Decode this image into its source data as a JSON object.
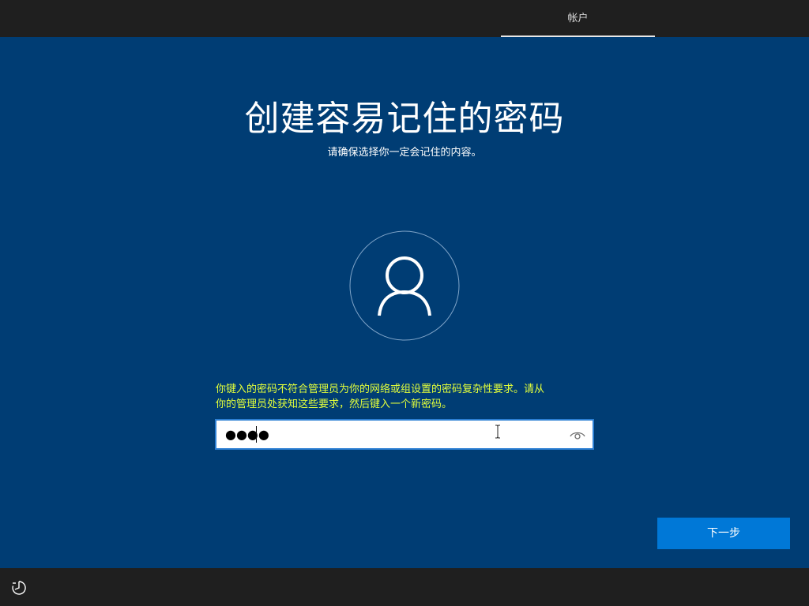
{
  "header": {
    "active_tab_label": "帐户"
  },
  "main": {
    "title": "创建容易记住的密码",
    "subtitle": "请确保选择你一定会记住的内容。",
    "avatar_icon": "user-icon",
    "error_line1": "你键入的密码不符合管理员为你的网络或组设置的密码复杂性要求。请从",
    "error_line2": "你的管理员处获知这些要求，然后键入一个新密码。",
    "error_color": "#e3ff3a",
    "password": {
      "masked_value": "●●●●",
      "reveal_icon": "eye-icon"
    },
    "next_button_label": "下一步"
  },
  "footer": {
    "accessibility_icon": "accessibility-icon"
  },
  "colors": {
    "background": "#003d74",
    "bars": "#1f1f1f",
    "accent": "#0078d7",
    "field_border": "#2c7fd3"
  }
}
